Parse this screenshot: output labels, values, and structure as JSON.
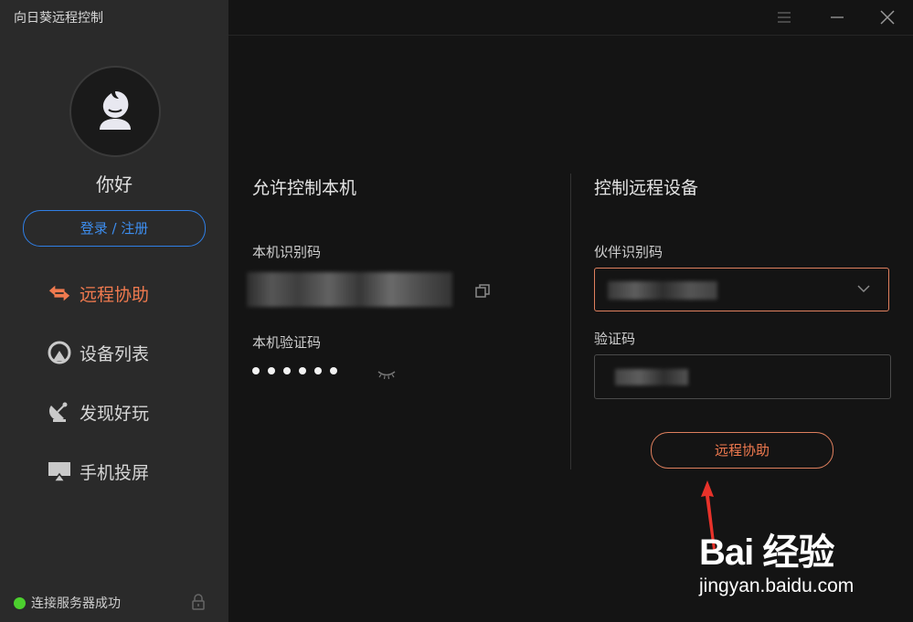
{
  "app": {
    "title": "向日葵远程控制"
  },
  "user": {
    "greeting": "你好",
    "login_label": "登录 / 注册"
  },
  "nav": {
    "items": [
      {
        "label": "远程协助",
        "icon": "remote-assist-icon",
        "active": true
      },
      {
        "label": "设备列表",
        "icon": "device-list-icon",
        "active": false
      },
      {
        "label": "发现好玩",
        "icon": "discover-icon",
        "active": false
      },
      {
        "label": "手机投屏",
        "icon": "screen-cast-icon",
        "active": false
      }
    ]
  },
  "status": {
    "text": "连接服务器成功",
    "color": "#4cd02e"
  },
  "local": {
    "title": "允许控制本机",
    "id_label": "本机识别码",
    "code_label": "本机验证码",
    "password_length": 6
  },
  "remote": {
    "title": "控制远程设备",
    "partner_label": "伙伴识别码",
    "code_label": "验证码",
    "connect_label": "远程协助"
  },
  "watermark": {
    "logo": "Bai 经验",
    "url": "jingyan.baidu.com"
  },
  "colors": {
    "accent": "#f07a4f",
    "login": "#2f7fe6",
    "sidebar": "#2a2a2a",
    "main": "#141414"
  }
}
